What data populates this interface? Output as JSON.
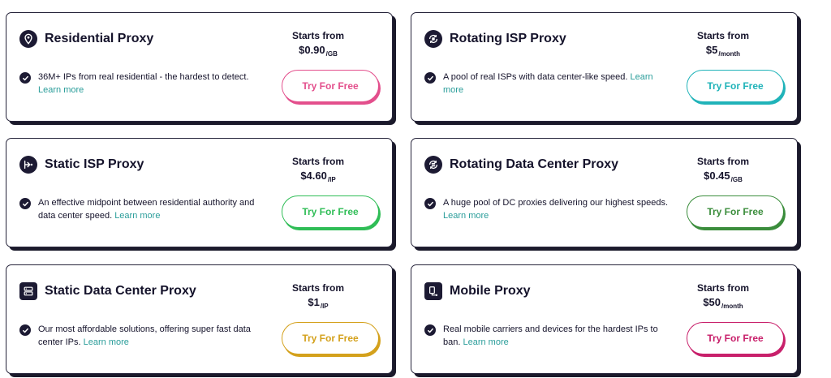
{
  "price_label": "Starts from",
  "check_icon_name": "check-circle-icon",
  "cards": [
    {
      "title": "Residential Proxy",
      "icon": "location-pin-icon",
      "price": "$0.90",
      "unit": "/GB",
      "description": "36M+ IPs from real residential - the hardest to detect.",
      "learn_more": "Learn more",
      "button": "Try For Free",
      "color": "#e34f8c"
    },
    {
      "title": "Rotating ISP Proxy",
      "icon": "rotate-cycle-icon",
      "price": "$5",
      "unit": "/month",
      "description": "A pool of real ISPs with data center-like speed.",
      "learn_more": "Learn more",
      "button": "Try For Free",
      "color": "#20b3b9"
    },
    {
      "title": "Static ISP Proxy",
      "icon": "network-arrow-icon",
      "price": "$4.60",
      "unit": "/IP",
      "description": "An effective midpoint between residential authority and data center speed.",
      "learn_more": "Learn more",
      "button": "Try For Free",
      "color": "#2fbd56"
    },
    {
      "title": "Rotating Data Center Proxy",
      "icon": "rotate-server-icon",
      "price": "$0.45",
      "unit": "/GB",
      "description": "A huge pool of DC proxies delivering our highest speeds.",
      "learn_more": "Learn more",
      "button": "Try For Free",
      "color": "#3b8d3c"
    },
    {
      "title": "Static Data Center Proxy",
      "icon": "server-rack-icon",
      "price": "$1",
      "unit": "/IP",
      "description": "Our most affordable solutions, offering super fast data center IPs.",
      "learn_more": "Learn more",
      "button": "Try For Free",
      "color": "#d4a11c"
    },
    {
      "title": "Mobile Proxy",
      "icon": "mobile-network-icon",
      "price": "$50",
      "unit": "/month",
      "description": "Real mobile carriers and devices for the hardest IPs to ban.",
      "learn_more": "Learn more",
      "button": "Try For Free",
      "color": "#c8206b"
    }
  ]
}
